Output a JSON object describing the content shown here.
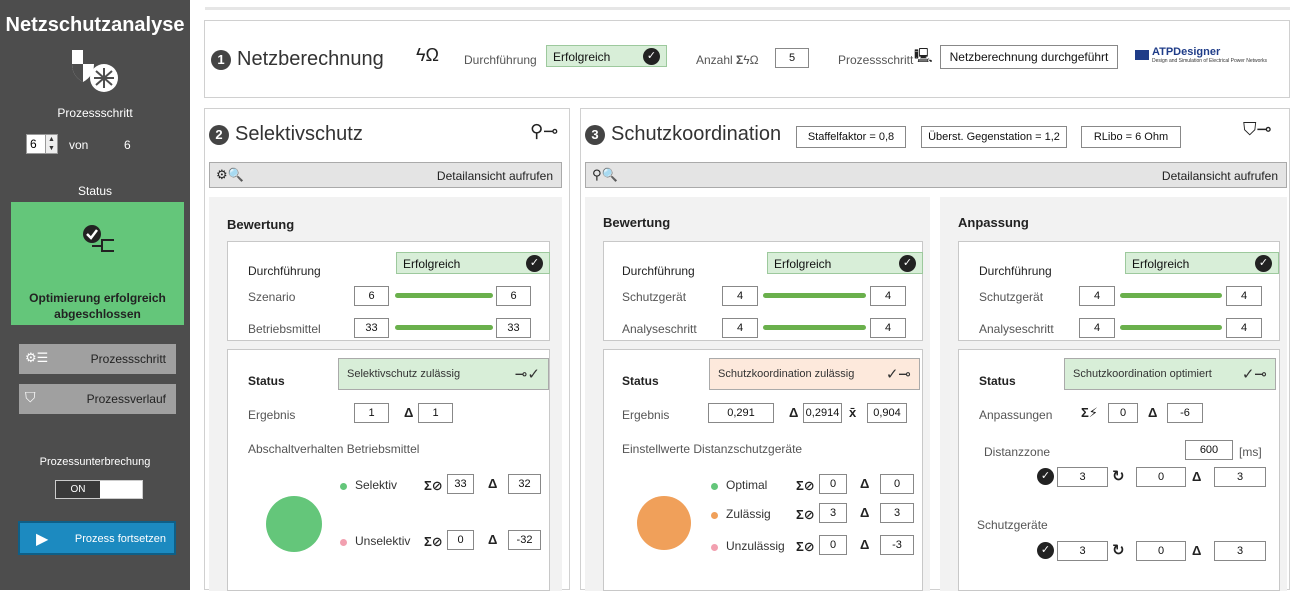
{
  "sidebar": {
    "title": "Netzschutzanalyse",
    "step_label": "Prozessschritt",
    "step_value": "6",
    "step_of": "von",
    "step_total": "6",
    "status_label": "Status",
    "status_text": "Optimierung erfolgreich abgeschlossen",
    "btn_process_step": "Prozessschritt",
    "btn_process_history": "Prozessverlauf",
    "interrupt_label": "Prozessunterbrechung",
    "toggle_on": "ON",
    "continue_button": "Prozess fortsetzen",
    "status_color": "#64c67a"
  },
  "top": {
    "num": "1",
    "title": "Netzberechnung",
    "execution_label": "Durchführung",
    "execution_value": "Erfolgreich",
    "count_label": "Anzahl",
    "count_value": "5",
    "step_label": "Prozessschritt",
    "step_value": "Netzberechnung durchgeführt",
    "logo_title": "ATPDesigner",
    "logo_sub": "Design and Simulation of Electrical Power Networks"
  },
  "selective": {
    "num": "2",
    "title": "Selektivschutz",
    "detail_button": "Detailansicht aufrufen",
    "section": "Bewertung",
    "execution_label": "Durchführung",
    "execution_value": "Erfolgreich",
    "row1_label": "Szenario",
    "row1_a": "6",
    "row1_b": "6",
    "row2_label": "Betriebsmittel",
    "row2_a": "33",
    "row2_b": "33",
    "status_label": "Status",
    "status_value": "Selektivschutz zulässig",
    "result_label": "Ergebnis",
    "result_value": "1",
    "result_delta": "1",
    "behavior_label": "Abschaltverhalten Betriebsmittel",
    "legend_selective": "Selektiv",
    "selective_sum": "33",
    "selective_delta": "32",
    "legend_unselective": "Unselektiv",
    "unselective_sum": "0",
    "unselective_delta": "-32"
  },
  "coordination": {
    "num": "3",
    "title": "Schutzkoordination",
    "factor": "Staffelfaktor = 0,8",
    "overexcitation": "Überst. Gegenstation = 1,2",
    "rlibo": "RLibo = 6 Ohm",
    "detail_button": "Detailansicht aufrufen",
    "eval": {
      "section": "Bewertung",
      "execution_label": "Durchführung",
      "execution_value": "Erfolgreich",
      "row1_label": "Schutzgerät",
      "row1_a": "4",
      "row1_b": "4",
      "row2_label": "Analyseschritt",
      "row2_a": "4",
      "row2_b": "4",
      "status_label": "Status",
      "status_value": "Schutzkoordination zulässig",
      "result_label": "Ergebnis",
      "result_value": "0,291",
      "result_delta": "0,2914",
      "result_mean": "0,904",
      "settings_label": "Einstellwerte Distanzschutzgeräte",
      "legend_optimal": "Optimal",
      "optimal_sum": "0",
      "optimal_delta": "0",
      "legend_allowed": "Zulässig",
      "allowed_sum": "3",
      "allowed_delta": "3",
      "legend_notallowed": "Unzulässig",
      "notallowed_sum": "0",
      "notallowed_delta": "-3"
    },
    "adapt": {
      "section": "Anpassung",
      "execution_label": "Durchführung",
      "execution_value": "Erfolgreich",
      "row1_label": "Schutzgerät",
      "row1_a": "4",
      "row1_b": "4",
      "row2_label": "Analyseschritt",
      "row2_a": "4",
      "row2_b": "4",
      "status_label": "Status",
      "status_value": "Schutzkoordination optimiert",
      "adjust_label": "Anpassungen",
      "adjust_value": "0",
      "adjust_delta": "-6",
      "zone_label": "Distanzzone",
      "zone_value": "600",
      "zone_unit": "[ms]",
      "zone_ok": "3",
      "zone_changed": "0",
      "zone_delta": "3",
      "devices_label": "Schutzgeräte",
      "devices_ok": "3",
      "devices_changed": "0",
      "devices_delta": "3"
    }
  },
  "colors": {
    "green": "#6ab04c",
    "orange": "#f0a05a",
    "pink": "#f2a0b0",
    "pie_green": "#64c67a",
    "pie_orange": "#f0a05a"
  }
}
